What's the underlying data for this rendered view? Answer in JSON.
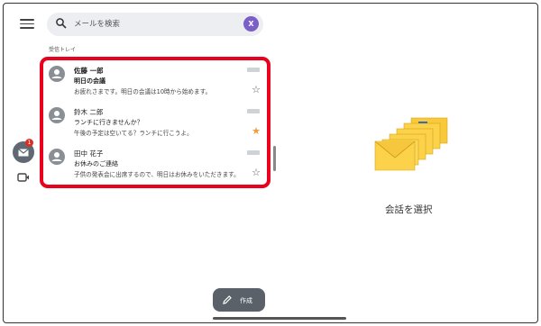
{
  "search": {
    "placeholder": "メールを検索",
    "account_initial": "X"
  },
  "rail": {
    "mail_badge": "1"
  },
  "inbox": {
    "label": "受信トレイ",
    "messages": [
      {
        "sender": "佐藤 一郎",
        "subject": "明日の会議",
        "snippet": "お疲れさまです。明日の会議は10時から始めます。",
        "unread": true,
        "starred": false
      },
      {
        "sender": "鈴木 二郎",
        "subject": "ランチに行きませんか？",
        "snippet": "午後の予定は空いてる？ランチに行こうよ。",
        "unread": false,
        "starred": true
      },
      {
        "sender": "田中 花子",
        "subject": "お休みのご連絡",
        "snippet": "子供の発表会に出席するので、明日はお休みをいただきます。",
        "unread": false,
        "starred": false
      }
    ]
  },
  "reading_pane": {
    "empty_text": "会話を選択"
  },
  "compose": {
    "label": "作成"
  },
  "colors": {
    "highlight": "#e8001c",
    "star_on": "#f29b38",
    "account": "#7b5ec7"
  }
}
